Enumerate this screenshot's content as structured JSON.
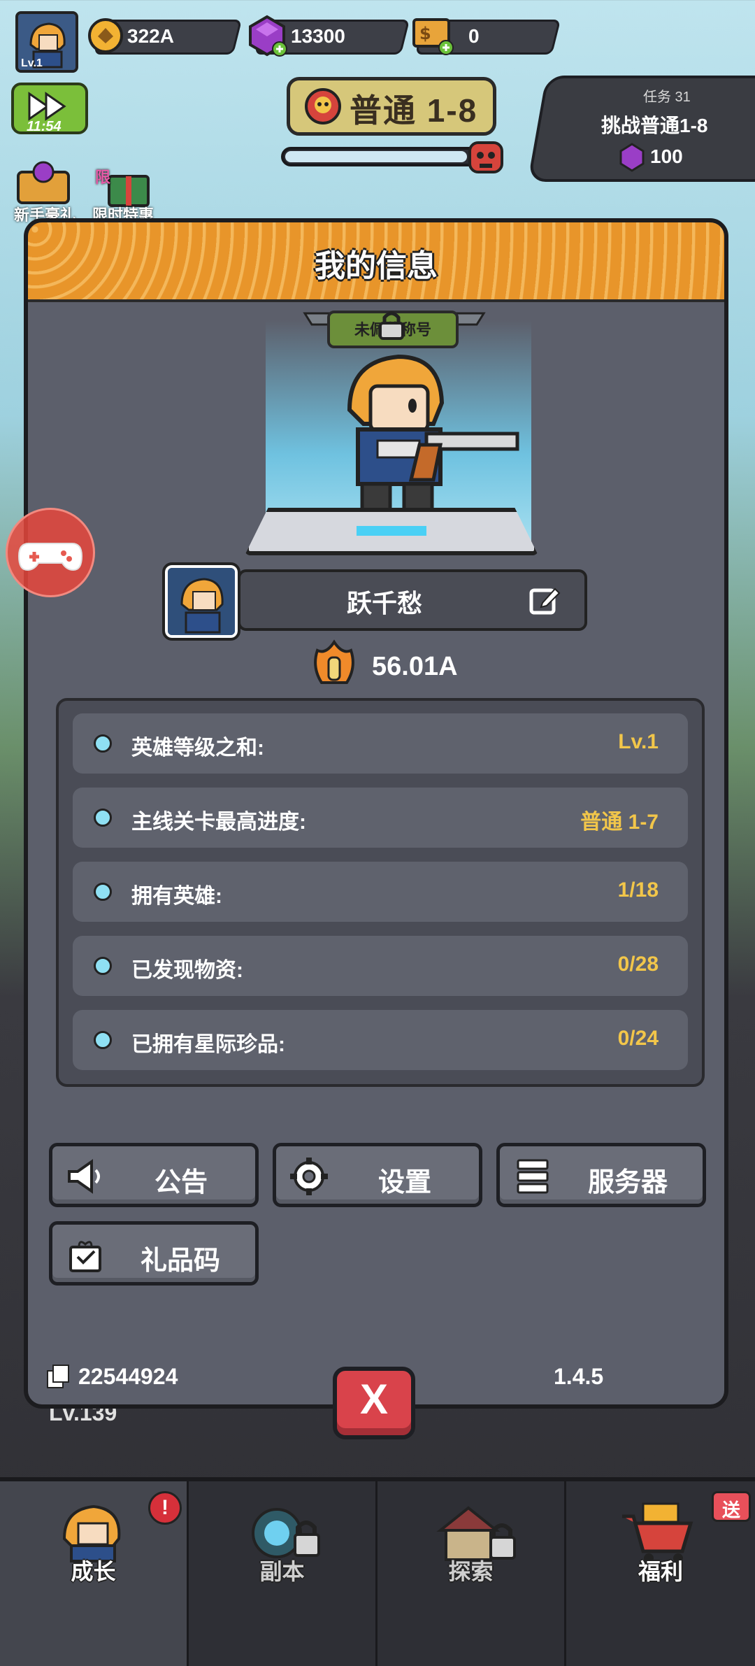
{
  "top_bar": {
    "player_level": "Lv.1",
    "gold": "322A",
    "gems": "13300",
    "tickets": "0",
    "fast_forward_time": "11:54",
    "stage": "普通 1-8"
  },
  "task": {
    "label": "任务 31",
    "title": "挑战普通1-8",
    "reward": "100"
  },
  "side_icons": {
    "newbie": "新手豪礼",
    "limited": "限时特惠",
    "limited_badge": "限"
  },
  "modal": {
    "title": "我的信息",
    "title_badge": "未佩戴称号",
    "player_name": "跃千愁",
    "combat_power": "56.01A",
    "stats": [
      {
        "label": "英雄等级之和:",
        "value": "Lv.1"
      },
      {
        "label": "主线关卡最高进度:",
        "value": "普通 1-7"
      },
      {
        "label": "拥有英雄:",
        "value": "1/18"
      },
      {
        "label": "已发现物资:",
        "value": "0/28"
      },
      {
        "label": "已拥有星际珍品:",
        "value": "0/24"
      }
    ],
    "buttons": {
      "announcement": "公告",
      "settings": "设置",
      "server": "服务器",
      "gift_code": "礼品码"
    },
    "uid": "22544924",
    "version": "1.4.5",
    "close_label": "X"
  },
  "background": {
    "hero_level": "Lv.139"
  },
  "bottom_nav": {
    "growth": "成长",
    "dungeon": "副本",
    "explore": "探索",
    "welfare": "福利",
    "welfare_badge": "送",
    "growth_alert": "!"
  },
  "colors": {
    "header_orange": "#e8952a",
    "modal_bg": "#5c5f6b",
    "stat_value": "#f2c64a",
    "stat_dot": "#8fe0f3",
    "close_red": "#d9434b"
  }
}
